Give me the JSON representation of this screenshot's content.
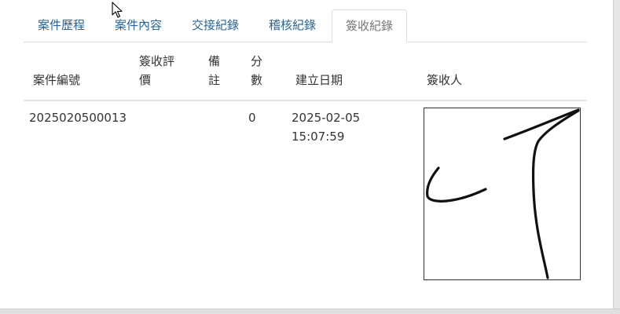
{
  "tabs": [
    {
      "label": "案件歷程",
      "active": false
    },
    {
      "label": "案件內容",
      "active": false
    },
    {
      "label": "交接紀錄",
      "active": false
    },
    {
      "label": "稽核紀錄",
      "active": false
    },
    {
      "label": "簽收紀錄",
      "active": true
    }
  ],
  "table": {
    "headers": {
      "case_no": "案件編號",
      "rating_line1": "簽收評",
      "rating_line2": "價",
      "note_line1": "備",
      "note_line2": "註",
      "score_line1": "分",
      "score_line2": "數",
      "created": "建立日期",
      "signer": "簽收人"
    },
    "rows": [
      {
        "case_no": "2025020500013",
        "rating": "",
        "note": "",
        "score": "0",
        "created_date": "2025-02-05",
        "created_time": "15:07:59"
      }
    ]
  },
  "colors": {
    "tab_link": "#2a6496",
    "tab_active": "#777777",
    "text": "#333333",
    "border": "#dddddd"
  },
  "icons": [
    "mouse-pointer-icon"
  ]
}
